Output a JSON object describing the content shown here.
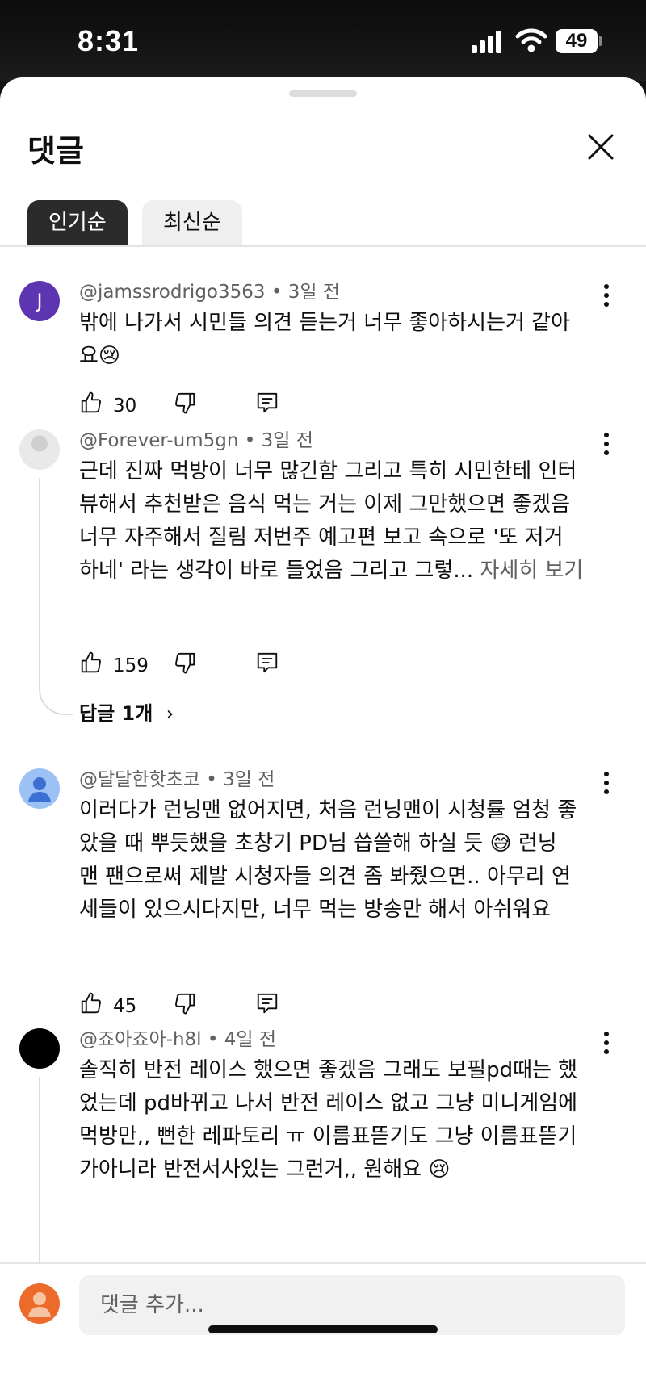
{
  "status": {
    "time": "8:31",
    "battery": "49"
  },
  "sheet": {
    "title": "댓글",
    "tabs": [
      {
        "label": "인기순"
      },
      {
        "label": "최신순"
      }
    ]
  },
  "comments": [
    {
      "avatar_letter": "J",
      "author": "@jamssrodrigo3563",
      "age": "3일 전",
      "text_line1": "밖에 나가서 시민들 의견 듣는거 너무 좋아하시는거 같아",
      "text_line2": "요",
      "emoji": "😢",
      "likes": "30"
    },
    {
      "author": "@Forever-um5gn",
      "age": "3일 전",
      "text_line1": "근데 진짜 먹방이 너무 많긴함 그리고 특히 시민한테 인터",
      "text_line2": "뷰해서 추천받은 음식 먹는 거는 이제 그만했으면 좋겠음",
      "text_line3": "너무 자주해서 질림 저번주 예고편 보고 속으로 '또 저거",
      "text_line4": "하네' 라는 생각이 바로 들었음 그리고 그렇...",
      "more": "자세히 보기",
      "likes": "159",
      "replies_label": "답글 1개"
    },
    {
      "author": "@달달한핫초코",
      "age": "3일 전",
      "text_line1": "이러다가 런닝맨 없어지면, 처음 런닝맨이 시청률 엄청 좋",
      "text_line2a": "았을 때 뿌듯했을 초창기 PD님 씁쓸해 하실 듯",
      "emoji": "😅",
      "text_line2b": "런닝",
      "text_line3": "맨 팬으로써 제발 시청자들 의견 좀 봐줬으면.. 아무리 연",
      "text_line4": "세들이 있으시다지만, 너무 먹는 방송만 해서 아쉬워요",
      "likes": "45"
    },
    {
      "author": "@죠아죠아-h8l",
      "age": "4일 전",
      "text_line1": "솔직히 반전 레이스 했으면 좋겠음 그래도 보필pd때는 했",
      "text_line2": "었는데 pd바뀌고 나서 반전 레이스 없고 그냥 미니게임에",
      "text_line3": "먹방만,, 뻔한 레파토리 ㅠ 이름표뜯기도 그냥 이름표뜯기",
      "text_line4": "가아니라 반전서사있는 그런거,, 원해요",
      "emoji": "😢"
    }
  ],
  "composer": {
    "placeholder": "댓글 추가..."
  },
  "colors": {
    "accent_dark": "#2b2b2b",
    "avatar_purple": "#5e35b1",
    "avatar_blue": "#7aa5e6",
    "avatar_orange": "#ec6b2b"
  }
}
